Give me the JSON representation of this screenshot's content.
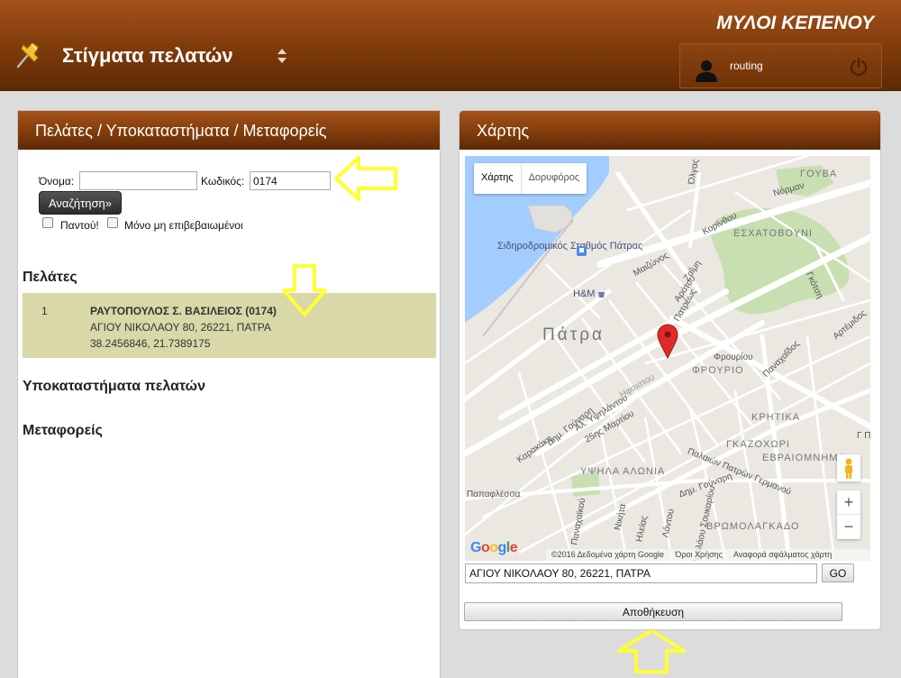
{
  "header": {
    "page_title": "Στίγματα πελατών",
    "company": "ΜΥΛΟΙ ΚΕΠΕΝΟΥ",
    "username": "routing",
    "icons": [
      "pushpin-icon",
      "sort-icon",
      "user-icon",
      "power-icon"
    ]
  },
  "left_panel": {
    "title": "Πελάτες / Υποκαταστήματα / Μεταφορείς",
    "search": {
      "name_label": "Όνομα:",
      "name_value": "",
      "code_label": "Κωδικός:",
      "code_value": "0174",
      "button": "Αναζήτηση»",
      "everywhere_label": "Παντού!",
      "everywhere_checked": false,
      "unconfirmed_label": "Μόνο μη επιβεβαιωμένοι",
      "unconfirmed_checked": false
    },
    "customers_title": "Πελάτες",
    "customers": [
      {
        "num": "1",
        "name": "ΡΑΥΤΟΠΟΥΛΟΣ Σ. ΒΑΣΙΛΕΙΟΣ (0174)",
        "address": "ΑΓΙΟΥ ΝΙΚΟΛΑΟΥ 80, 26221, ΠΑΤΡΑ",
        "coords": "38.2456846, 21.7389175"
      }
    ],
    "branches_title": "Υποκαταστήματα πελατών",
    "carriers_title": "Μεταφορείς"
  },
  "right_panel": {
    "title": "Χάρτης",
    "map": {
      "type_map": "Χάρτης",
      "type_satellite": "Δορυφόρος",
      "city_label": "Πάτρα",
      "districts": [
        "ΓΟΥΒΑ",
        "ΕΣΧΑΤΟΒΟΥΝΙ",
        "ΦΡΟΥΡΙΟ",
        "ΚΡΗΤΙΚΑ",
        "ΓΚΑΖΟΧΩΡΙ",
        "ΕΒΡΑΙΟΜΝΗΜΑ",
        "ΥΨΗΛΑ ΑΛΩΝΙΑ",
        "ΒΡΩΜΟΛΑΓΚΑΔΟ"
      ],
      "streets": [
        "Όλγας",
        "Νόρμαν",
        "Κορίνθου",
        "Μαιζώνος",
        "Ζαΐμη",
        "Αράτου",
        "Γκότση",
        "Αρτέμιδος",
        "Φρουρίου",
        "Παναχαΐδος",
        "Πατρέως",
        "Αλ. Υψηλάντου",
        "25ης Μαρτίου",
        "Ηφαιστου",
        "Καρακάκη",
        "Δημ. Γούναρη",
        "Παλαιών Πατρών Γερμανού",
        "Παπαφλέσσα",
        "Νικήτα",
        "Ηλείας",
        "Λόντου",
        "Νικολάου Σουκαρίου",
        "Παναχαϊκού",
        "Γ Π"
      ],
      "pois": [
        "Σιδηροδρομικός Σταθμός Πάτρας",
        "H&M"
      ],
      "zoom_in": "+",
      "zoom_out": "−",
      "logo": "Google",
      "attribution": "©2016 Δεδομένα χάρτη Google",
      "terms": "Όροι Χρήσης",
      "report": "Αναφορά σφάλματος χάρτη",
      "colors": {
        "water": "#a3ccff",
        "park": "#c8dfb2",
        "road": "#ffffff",
        "land": "#ebe8e2",
        "pin": "#e02a2a"
      }
    },
    "address_value": "ΑΓΙΟΥ ΝΙΚΟΛΑΟΥ 80, 26221, ΠΑΤΡΑ",
    "go_button": "GO",
    "save_button": "Αποθήκευση"
  },
  "annotations": {
    "arrow_color": "#ffff33"
  }
}
